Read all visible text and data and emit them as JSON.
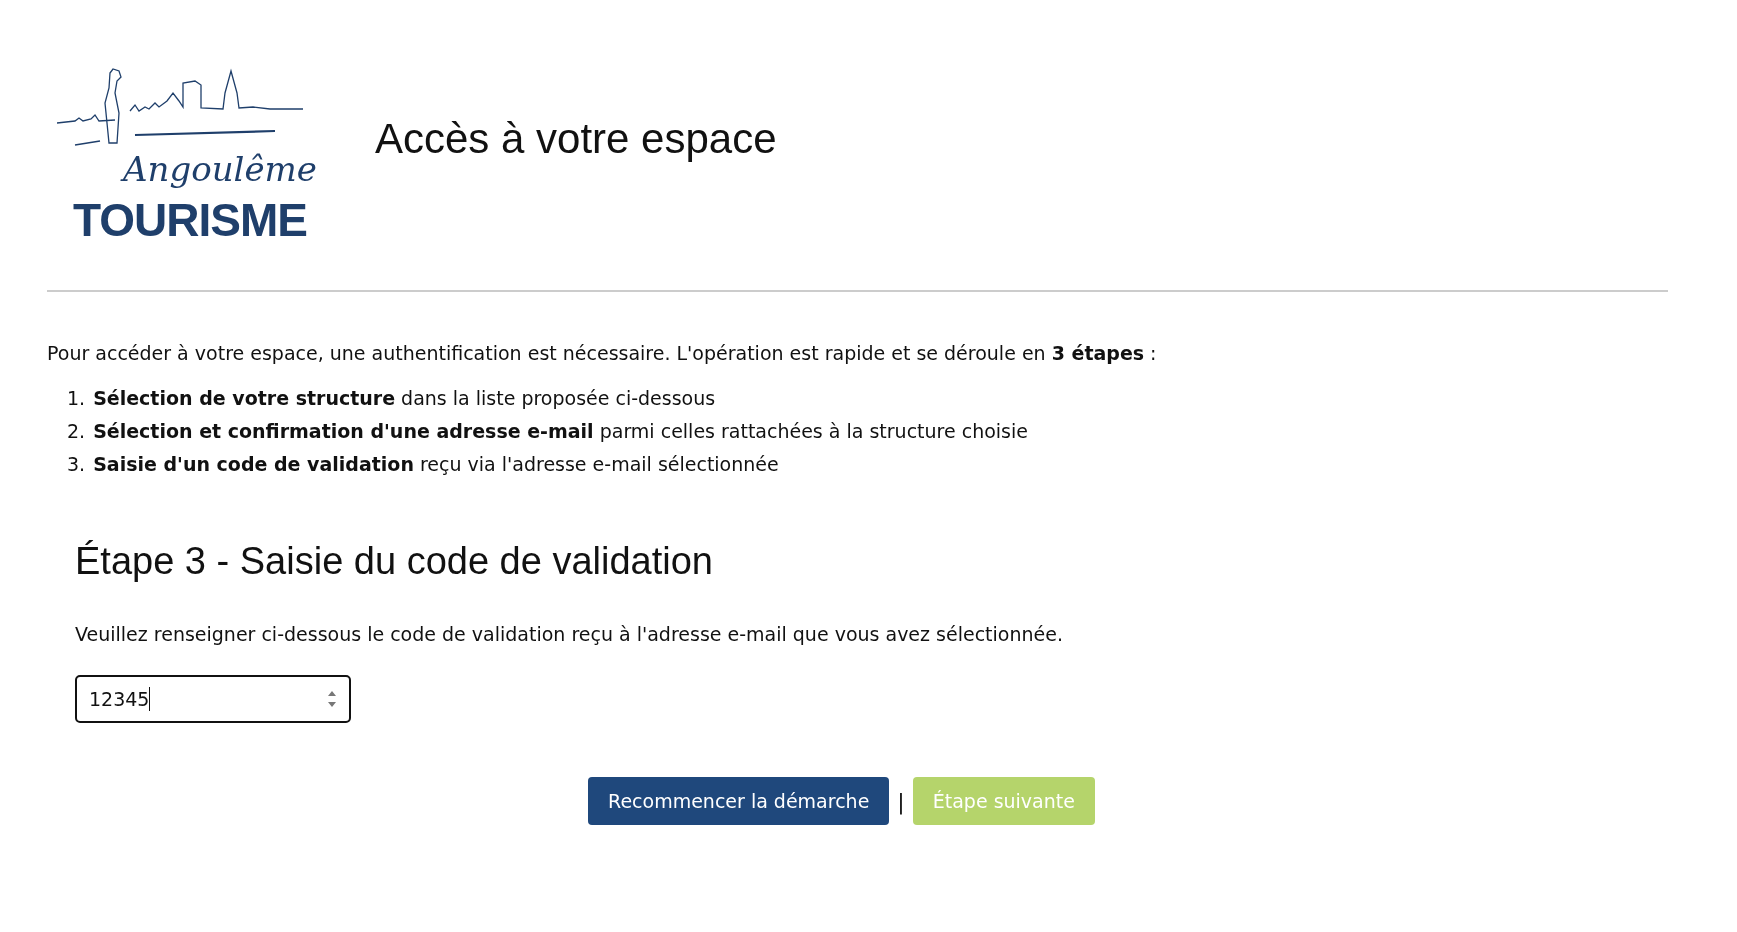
{
  "logo": {
    "script": "Angoulême",
    "wordmark": "TOURISME"
  },
  "title": "Accès à votre espace",
  "intro": "Pour accéder à votre espace, une authentification est nécessaire. L'opération est rapide et se déroule en **3 étapes** :",
  "steps": [
    {
      "number": "1.",
      "text": "**Sélection de votre structure** dans la liste proposée ci-dessous"
    },
    {
      "number": "2.",
      "text": "**Sélection et confirmation d'une adresse e-mail** parmi celles rattachées à la structure choisie"
    },
    {
      "number": "3.",
      "text": "**Saisie d'un code de validation** reçu via l'adresse e-mail sélectionnée"
    }
  ],
  "section": {
    "heading": "Étape 3 - Saisie du code de validation",
    "description": "Veuillez renseigner ci-dessous le code de validation reçu à l'adresse e-mail que vous avez sélectionnée.",
    "code_field": {
      "value": "12345",
      "focused": true
    }
  },
  "buttons": [
    {
      "label": "Recommencer la démarche",
      "kind": "primary",
      "disabled": false
    },
    {
      "label": "Étape suivante",
      "kind": "success",
      "disabled": true
    }
  ],
  "button_separator": "|"
}
